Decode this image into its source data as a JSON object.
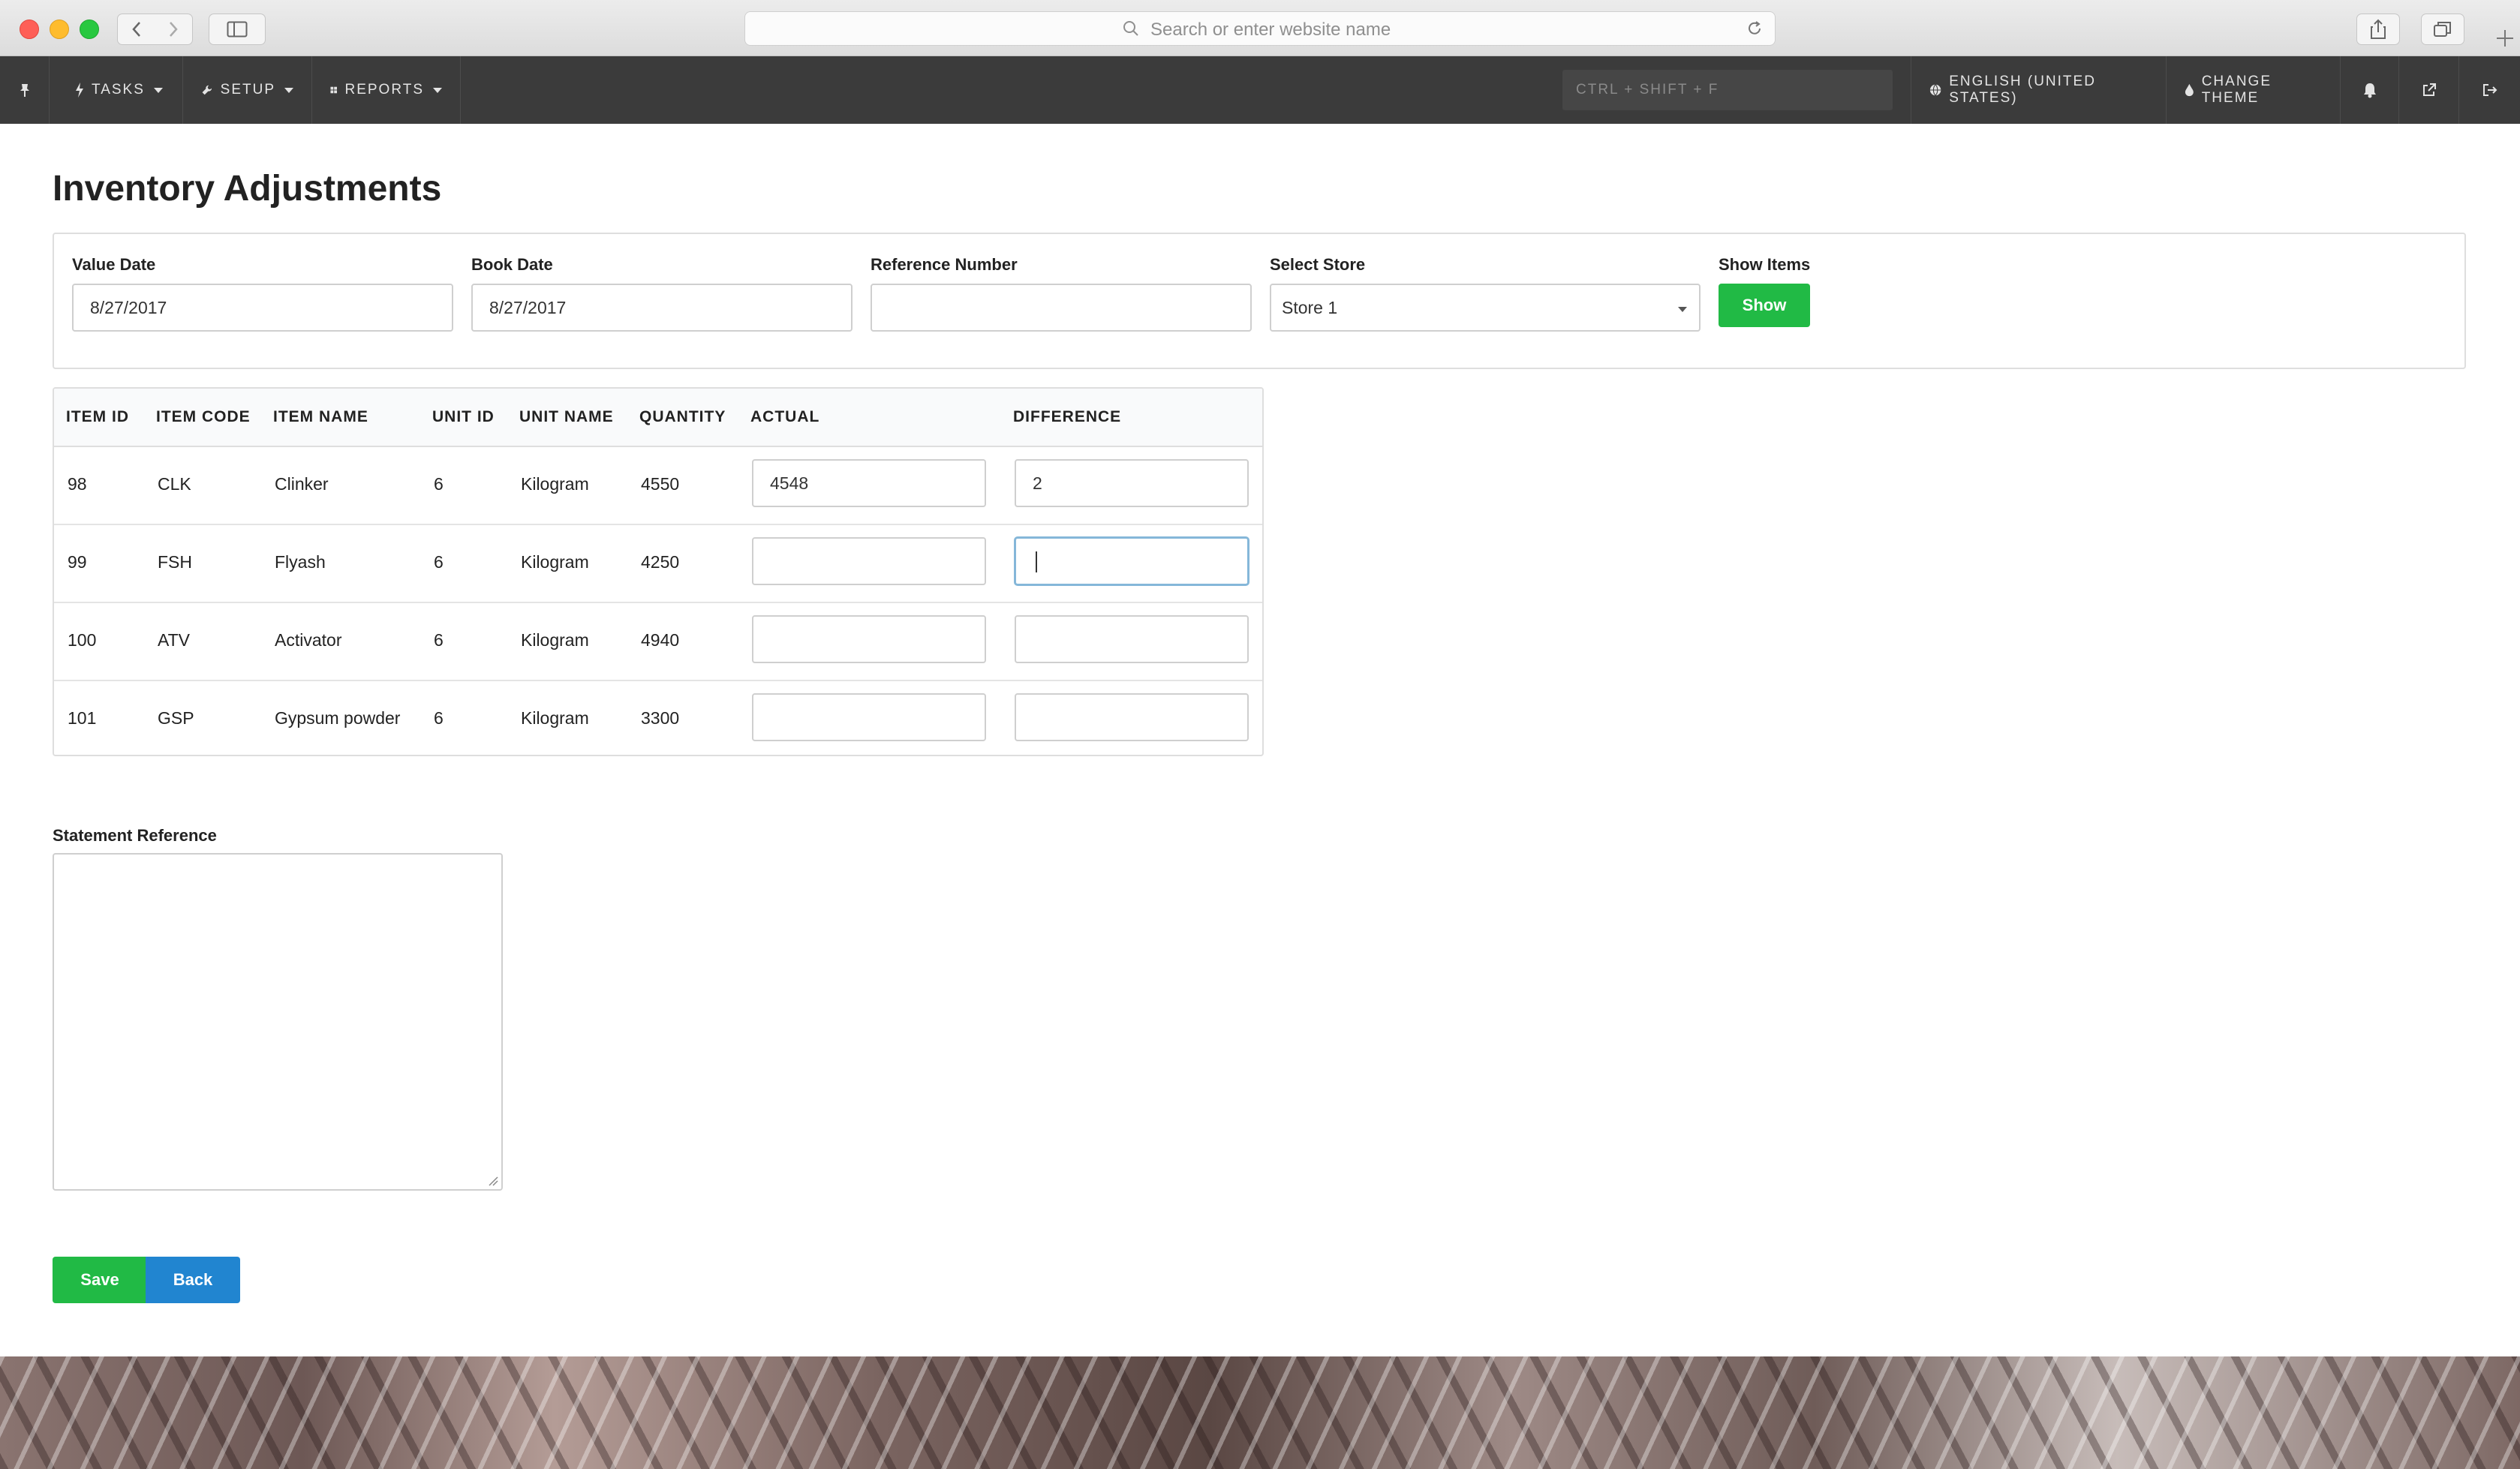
{
  "browser": {
    "address_placeholder": "Search or enter website name"
  },
  "appbar": {
    "tasks": "TASKS",
    "setup": "SETUP",
    "reports": "REPORTS",
    "quick_search_placeholder": "CTRL + SHIFT + F",
    "language": "ENGLISH (UNITED STATES)",
    "change_theme": "CHANGE THEME"
  },
  "page": {
    "title": "Inventory Adjustments"
  },
  "filters": {
    "value_date_label": "Value Date",
    "value_date": "8/27/2017",
    "book_date_label": "Book Date",
    "book_date": "8/27/2017",
    "reference_number_label": "Reference Number",
    "reference_number": "",
    "select_store_label": "Select Store",
    "selected_store": "Store 1",
    "show_items_label": "Show Items",
    "show_button": "Show"
  },
  "table": {
    "headers": {
      "item_id": "ITEM ID",
      "item_code": "ITEM CODE",
      "item_name": "ITEM NAME",
      "unit_id": "UNIT ID",
      "unit_name": "UNIT NAME",
      "quantity": "QUANTITY",
      "actual": "ACTUAL",
      "difference": "DIFFERENCE"
    },
    "rows": [
      {
        "item_id": "98",
        "item_code": "CLK",
        "item_name": "Clinker",
        "unit_id": "6",
        "unit_name": "Kilogram",
        "quantity": "4550",
        "actual": "4548",
        "difference": "2"
      },
      {
        "item_id": "99",
        "item_code": "FSH",
        "item_name": "Flyash",
        "unit_id": "6",
        "unit_name": "Kilogram",
        "quantity": "4250",
        "actual": "",
        "difference": ""
      },
      {
        "item_id": "100",
        "item_code": "ATV",
        "item_name": "Activator",
        "unit_id": "6",
        "unit_name": "Kilogram",
        "quantity": "4940",
        "actual": "",
        "difference": ""
      },
      {
        "item_id": "101",
        "item_code": "GSP",
        "item_name": "Gypsum powder",
        "unit_id": "6",
        "unit_name": "Kilogram",
        "quantity": "3300",
        "actual": "",
        "difference": ""
      }
    ]
  },
  "statement": {
    "label": "Statement Reference",
    "value": ""
  },
  "actions": {
    "save": "Save",
    "back": "Back"
  },
  "colors": {
    "appbar_bg": "#3b3b3b",
    "success_green": "#21ba45",
    "primary_blue": "#2185d0"
  }
}
